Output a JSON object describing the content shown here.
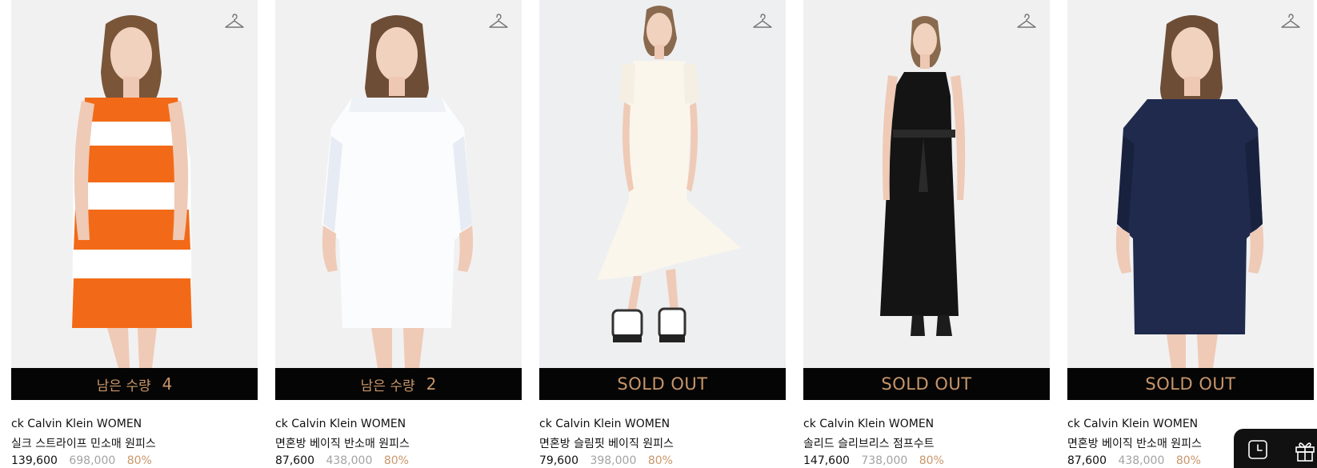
{
  "products": [
    {
      "stock_label": "남은 수량",
      "stock_count": "4",
      "sold_out_label": "",
      "brand": "ck Calvin Klein WOMEN",
      "name": "실크 스트라이프 민소매 원피스",
      "price": "139,600",
      "original_price": "698,000",
      "discount": "80%",
      "image_desc": "orange-white-stripe-dress"
    },
    {
      "stock_label": "남은 수량",
      "stock_count": "2",
      "sold_out_label": "",
      "brand": "ck Calvin Klein WOMEN",
      "name": "면혼방 베이직 반소매 원피스",
      "price": "87,600",
      "original_price": "438,000",
      "discount": "80%",
      "image_desc": "white-shift-dress"
    },
    {
      "stock_label": "",
      "stock_count": "",
      "sold_out_label": "SOLD OUT",
      "brand": "ck Calvin Klein WOMEN",
      "name": "면혼방 슬림핏 베이직 원피스",
      "price": "79,600",
      "original_price": "398,000",
      "discount": "80%",
      "image_desc": "ivory-asymmetric-dress"
    },
    {
      "stock_label": "",
      "stock_count": "",
      "sold_out_label": "SOLD OUT",
      "brand": "ck Calvin Klein WOMEN",
      "name": "솔리드 슬리브리스 점프수트",
      "price": "147,600",
      "original_price": "738,000",
      "discount": "80%",
      "image_desc": "black-sleeveless-jumpsuit"
    },
    {
      "stock_label": "",
      "stock_count": "",
      "sold_out_label": "SOLD OUT",
      "brand": "ck Calvin Klein WOMEN",
      "name": "면혼방 베이직 반소매 원피스",
      "price": "87,600",
      "original_price": "438,000",
      "discount": "80%",
      "image_desc": "navy-shift-dress"
    }
  ],
  "icons": {
    "wishlist": "hanger-icon",
    "recent": "clock-icon",
    "gift": "gift-icon"
  },
  "colors": {
    "status_bar_bg": "#050505",
    "accent": "#c9966a",
    "original_price": "#a3a3a3",
    "text": "#111111",
    "photo_bg": "#f1f1f2"
  }
}
